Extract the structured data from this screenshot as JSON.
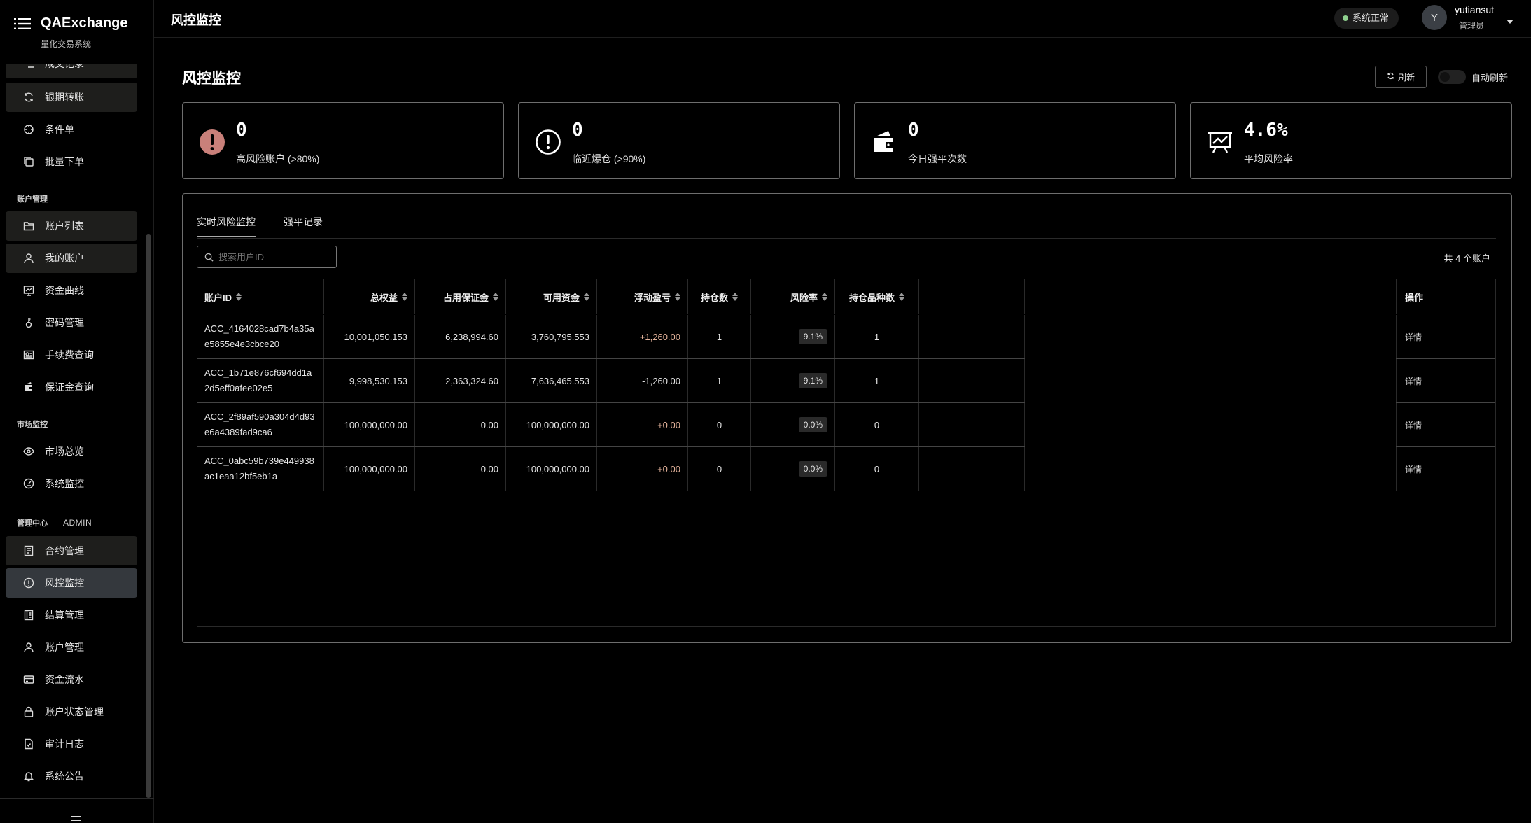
{
  "app": {
    "name": "QAExchange",
    "subtitle": "量化交易系统"
  },
  "header": {
    "title": "风控监控",
    "system_status": "系统正常",
    "status_color": "#8fd08f",
    "user": {
      "initial": "Y",
      "name": "yutiansut",
      "role": "管理员"
    }
  },
  "sidebar": {
    "items_top": [
      {
        "label": "成交记录",
        "icon": "list-check-icon"
      },
      {
        "label": "银期转账",
        "icon": "refresh-icon"
      },
      {
        "label": "条件单",
        "icon": "target-icon"
      },
      {
        "label": "批量下单",
        "icon": "copy-icon"
      }
    ],
    "sections": {
      "account": "账户管理",
      "market": "市场监控",
      "admin": "管理中心",
      "admin_badge": "ADMIN"
    },
    "account_items": [
      {
        "label": "账户列表",
        "icon": "folder-icon"
      },
      {
        "label": "我的账户",
        "icon": "user-icon"
      },
      {
        "label": "资金曲线",
        "icon": "chart-icon"
      },
      {
        "label": "密码管理",
        "icon": "key-icon"
      },
      {
        "label": "手续费查询",
        "icon": "receipt-icon"
      },
      {
        "label": "保证金查询",
        "icon": "wallet-icon"
      }
    ],
    "market_items": [
      {
        "label": "市场总览",
        "icon": "eye-icon"
      },
      {
        "label": "系统监控",
        "icon": "dashboard-icon"
      }
    ],
    "admin_items": [
      {
        "label": "合约管理",
        "icon": "document-icon"
      },
      {
        "label": "风控监控",
        "icon": "alert-icon"
      },
      {
        "label": "结算管理",
        "icon": "ledger-icon"
      },
      {
        "label": "账户管理",
        "icon": "user-icon"
      },
      {
        "label": "资金流水",
        "icon": "card-icon"
      },
      {
        "label": "账户状态管理",
        "icon": "lock-icon"
      },
      {
        "label": "审计日志",
        "icon": "file-check-icon"
      },
      {
        "label": "系统公告",
        "icon": "bell-icon"
      }
    ]
  },
  "page": {
    "title": "风控监控",
    "refresh_label": "刷新",
    "auto_refresh_label": "自动刷新",
    "auto_refresh_on": false
  },
  "stats": [
    {
      "value": "0",
      "label": "高风险账户 (>80%)",
      "icon": "alert-circle-filled-icon"
    },
    {
      "value": "0",
      "label": "临近爆仓 (>90%)",
      "icon": "alert-circle-icon"
    },
    {
      "value": "0",
      "label": "今日强平次数",
      "icon": "wallet-icon"
    },
    {
      "value": "4.6%",
      "label": "平均风险率",
      "icon": "presentation-chart-icon"
    }
  ],
  "tabs": [
    {
      "label": "实时风险监控",
      "active": true
    },
    {
      "label": "强平记录",
      "active": false
    }
  ],
  "search": {
    "placeholder": "搜索用户ID",
    "value": ""
  },
  "total_count": "共 4 个账户",
  "table": {
    "columns": [
      "账户ID",
      "总权益",
      "占用保证金",
      "可用资金",
      "浮动盈亏",
      "持仓数",
      "风险率",
      "持仓品种数",
      "操作"
    ],
    "rows": [
      {
        "id": "ACC_4164028cad7b4a35ae5855e4e3cbce20",
        "equity": "10,001,050.153",
        "margin": "6,238,994.60",
        "available": "3,760,795.553",
        "pnl": "+1,260.00",
        "positions": "1",
        "risk": "9.1%",
        "varieties": "1",
        "action": "详情"
      },
      {
        "id": "ACC_1b71e876cf694dd1a2d5eff0afee02e5",
        "equity": "9,998,530.153",
        "margin": "2,363,324.60",
        "available": "7,636,465.553",
        "pnl": "-1,260.00",
        "positions": "1",
        "risk": "9.1%",
        "varieties": "1",
        "action": "详情"
      },
      {
        "id": "ACC_2f89af590a304d4d93e6a4389fad9ca6",
        "equity": "100,000,000.00",
        "margin": "0.00",
        "available": "100,000,000.00",
        "pnl": "+0.00",
        "positions": "0",
        "risk": "0.0%",
        "varieties": "0",
        "action": "详情"
      },
      {
        "id": "ACC_0abc59b739e449938ac1eaa12bf5eb1a",
        "equity": "100,000,000.00",
        "margin": "0.00",
        "available": "100,000,000.00",
        "pnl": "+0.00",
        "positions": "0",
        "risk": "0.0%",
        "varieties": "0",
        "action": "详情"
      }
    ]
  },
  "colors": {
    "pnl_positive": "#e3b29a",
    "active_nav": "#34383d",
    "danger_icon": "#c9807a"
  }
}
